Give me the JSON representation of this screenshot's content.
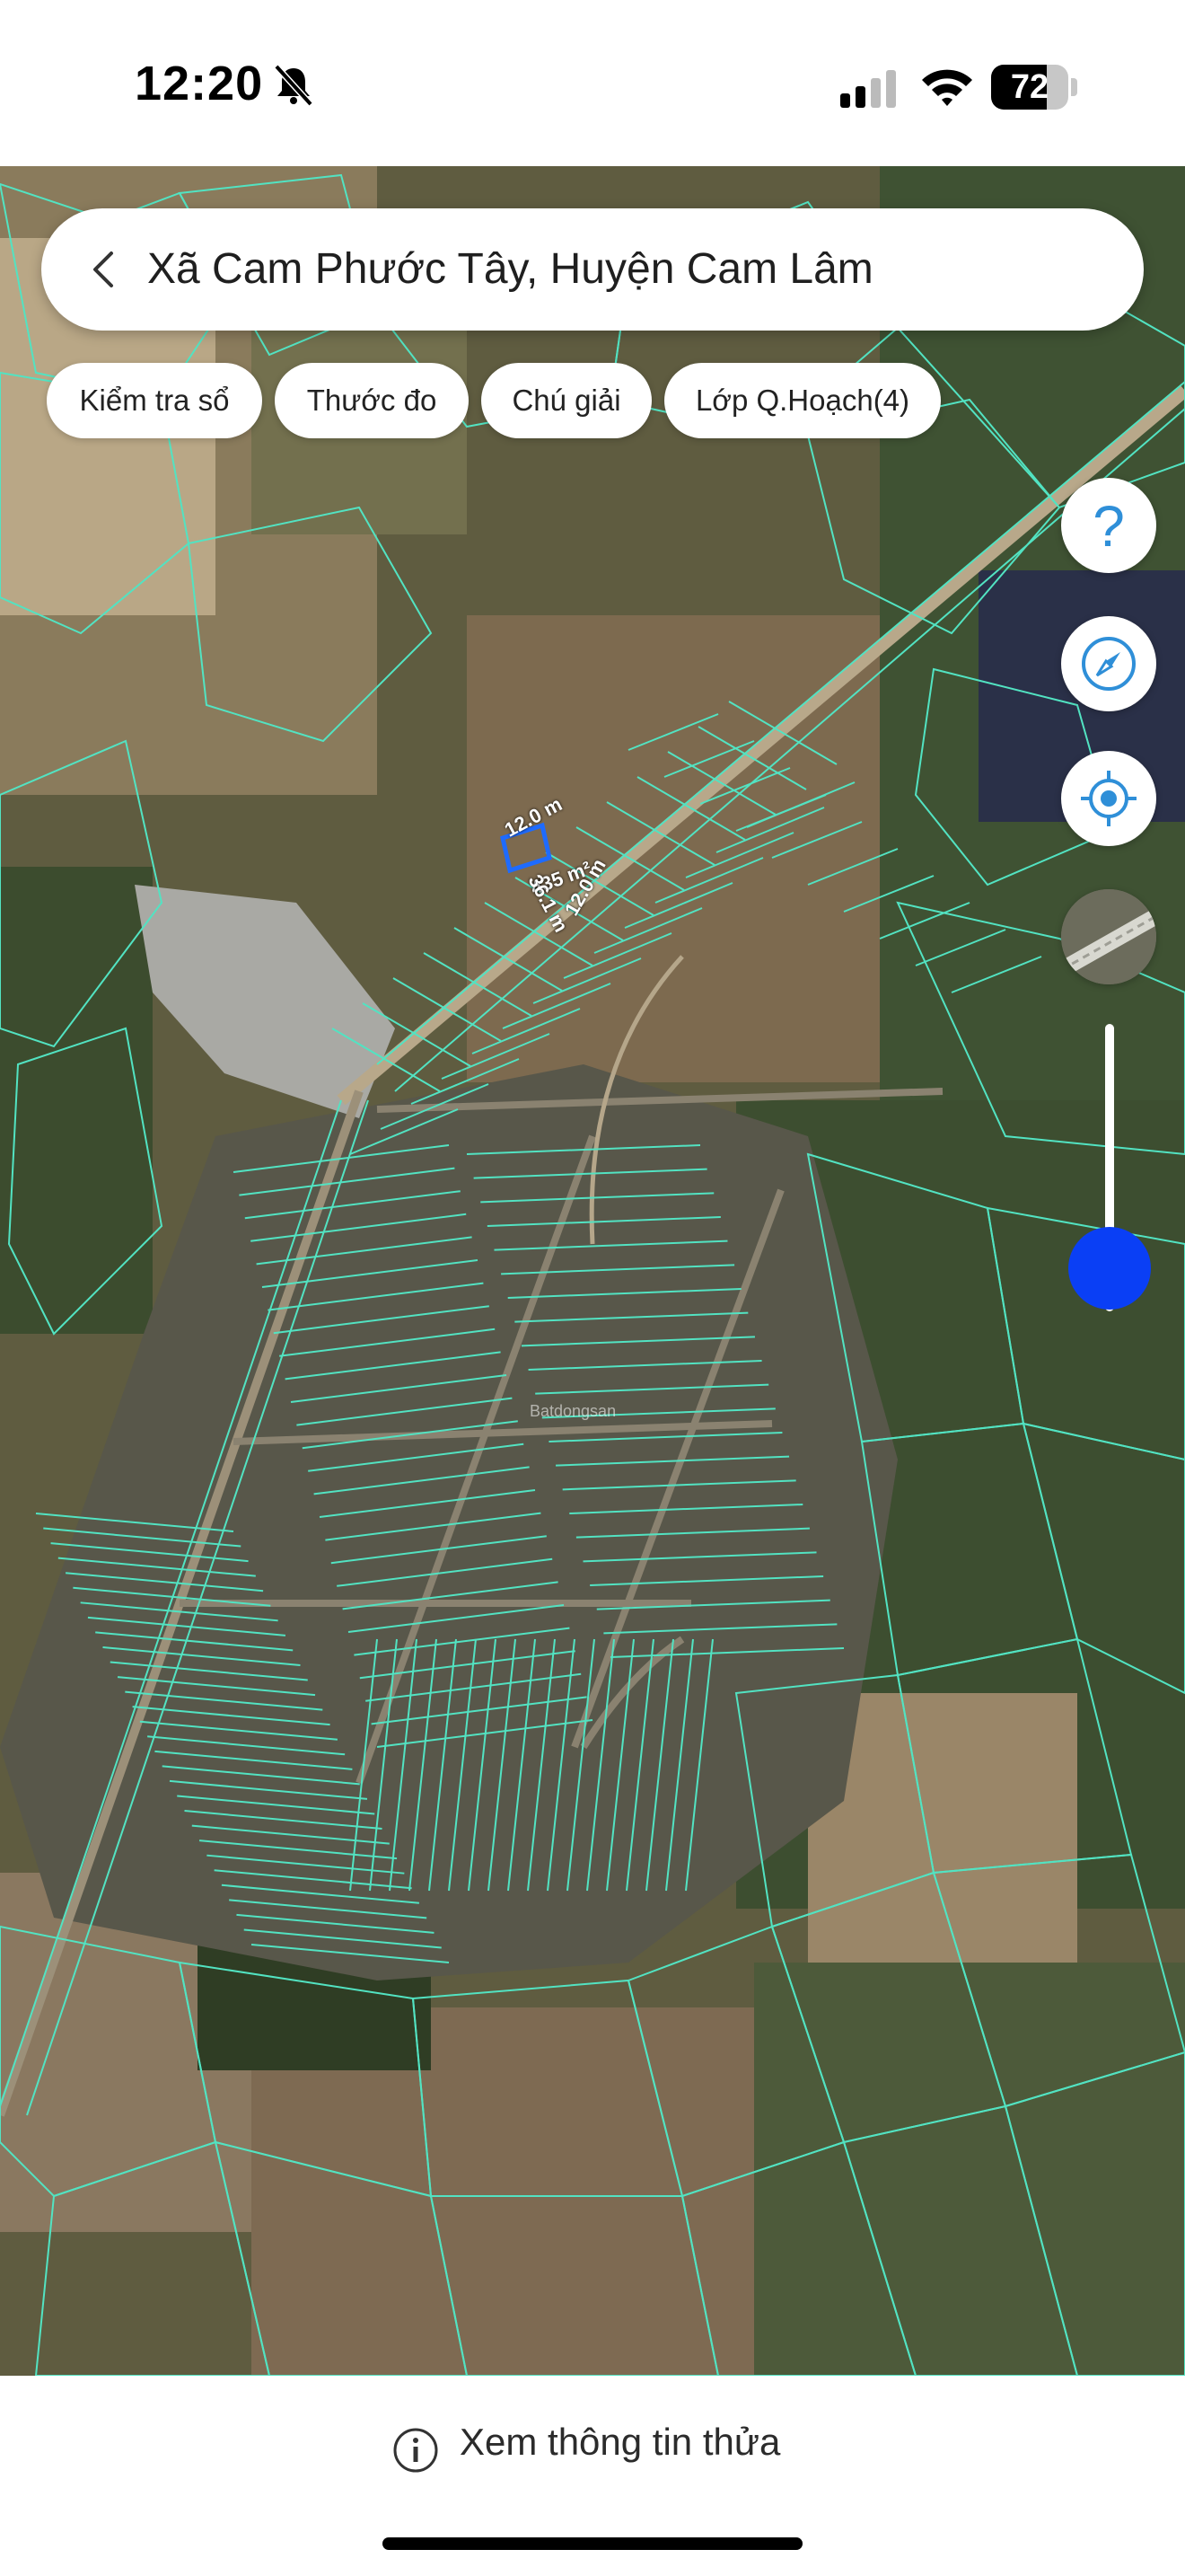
{
  "status_bar": {
    "time": "12:20",
    "battery_level": "72",
    "battery_fraction": 0.72
  },
  "search": {
    "title": "Xã Cam Phước Tây, Huyện Cam Lâm"
  },
  "chips": [
    {
      "label": "Kiểm tra sổ"
    },
    {
      "label": "Thước đo"
    },
    {
      "label": "Chú giải"
    },
    {
      "label": "Lớp Q.Hoạch(4)"
    }
  ],
  "map": {
    "measurements": {
      "width_label": "12.0 m",
      "area_label": "435 m²",
      "side_label": "12.0 m",
      "depth_label": "36.1 m"
    },
    "watermark": "Batdongsan",
    "parcel_line_color": "#52e3c2",
    "selected_parcel_color": "#1e6bff"
  },
  "controls": {
    "help_icon": "question-icon",
    "compass_icon": "compass-icon",
    "locate_icon": "crosshair-icon",
    "layer_icon": "layer-thumbnail",
    "slider_value": 0.15
  },
  "bottom": {
    "info_label": "Xem thông tin thửa"
  }
}
